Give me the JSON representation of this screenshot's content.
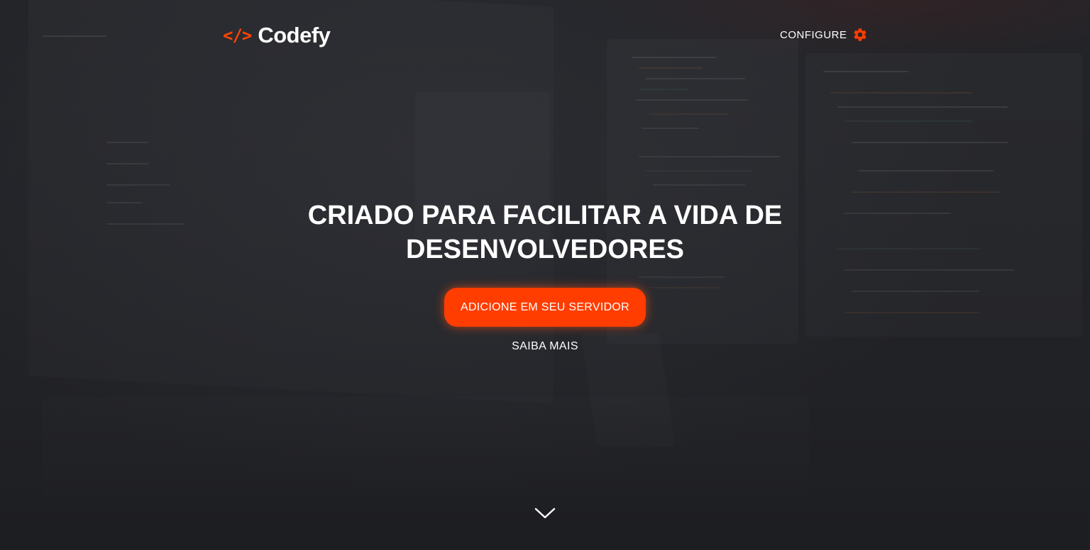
{
  "brand": {
    "icon": "</>",
    "name": "Codefy"
  },
  "nav": {
    "configure_label": "CONFIGURE",
    "configure_icon": "gear-icon"
  },
  "hero": {
    "title": "CRIADO PARA FACILITAR A VIDA DE DESENVOLVEDORES",
    "cta_label": "ADICIONE EM SEU SERVIDOR",
    "secondary_link": "SAIBA MAIS",
    "scroll_icon": "chevron-down-icon"
  },
  "colors": {
    "accent": "#ff3d00",
    "background": "#232428",
    "text": "#ffffff"
  }
}
